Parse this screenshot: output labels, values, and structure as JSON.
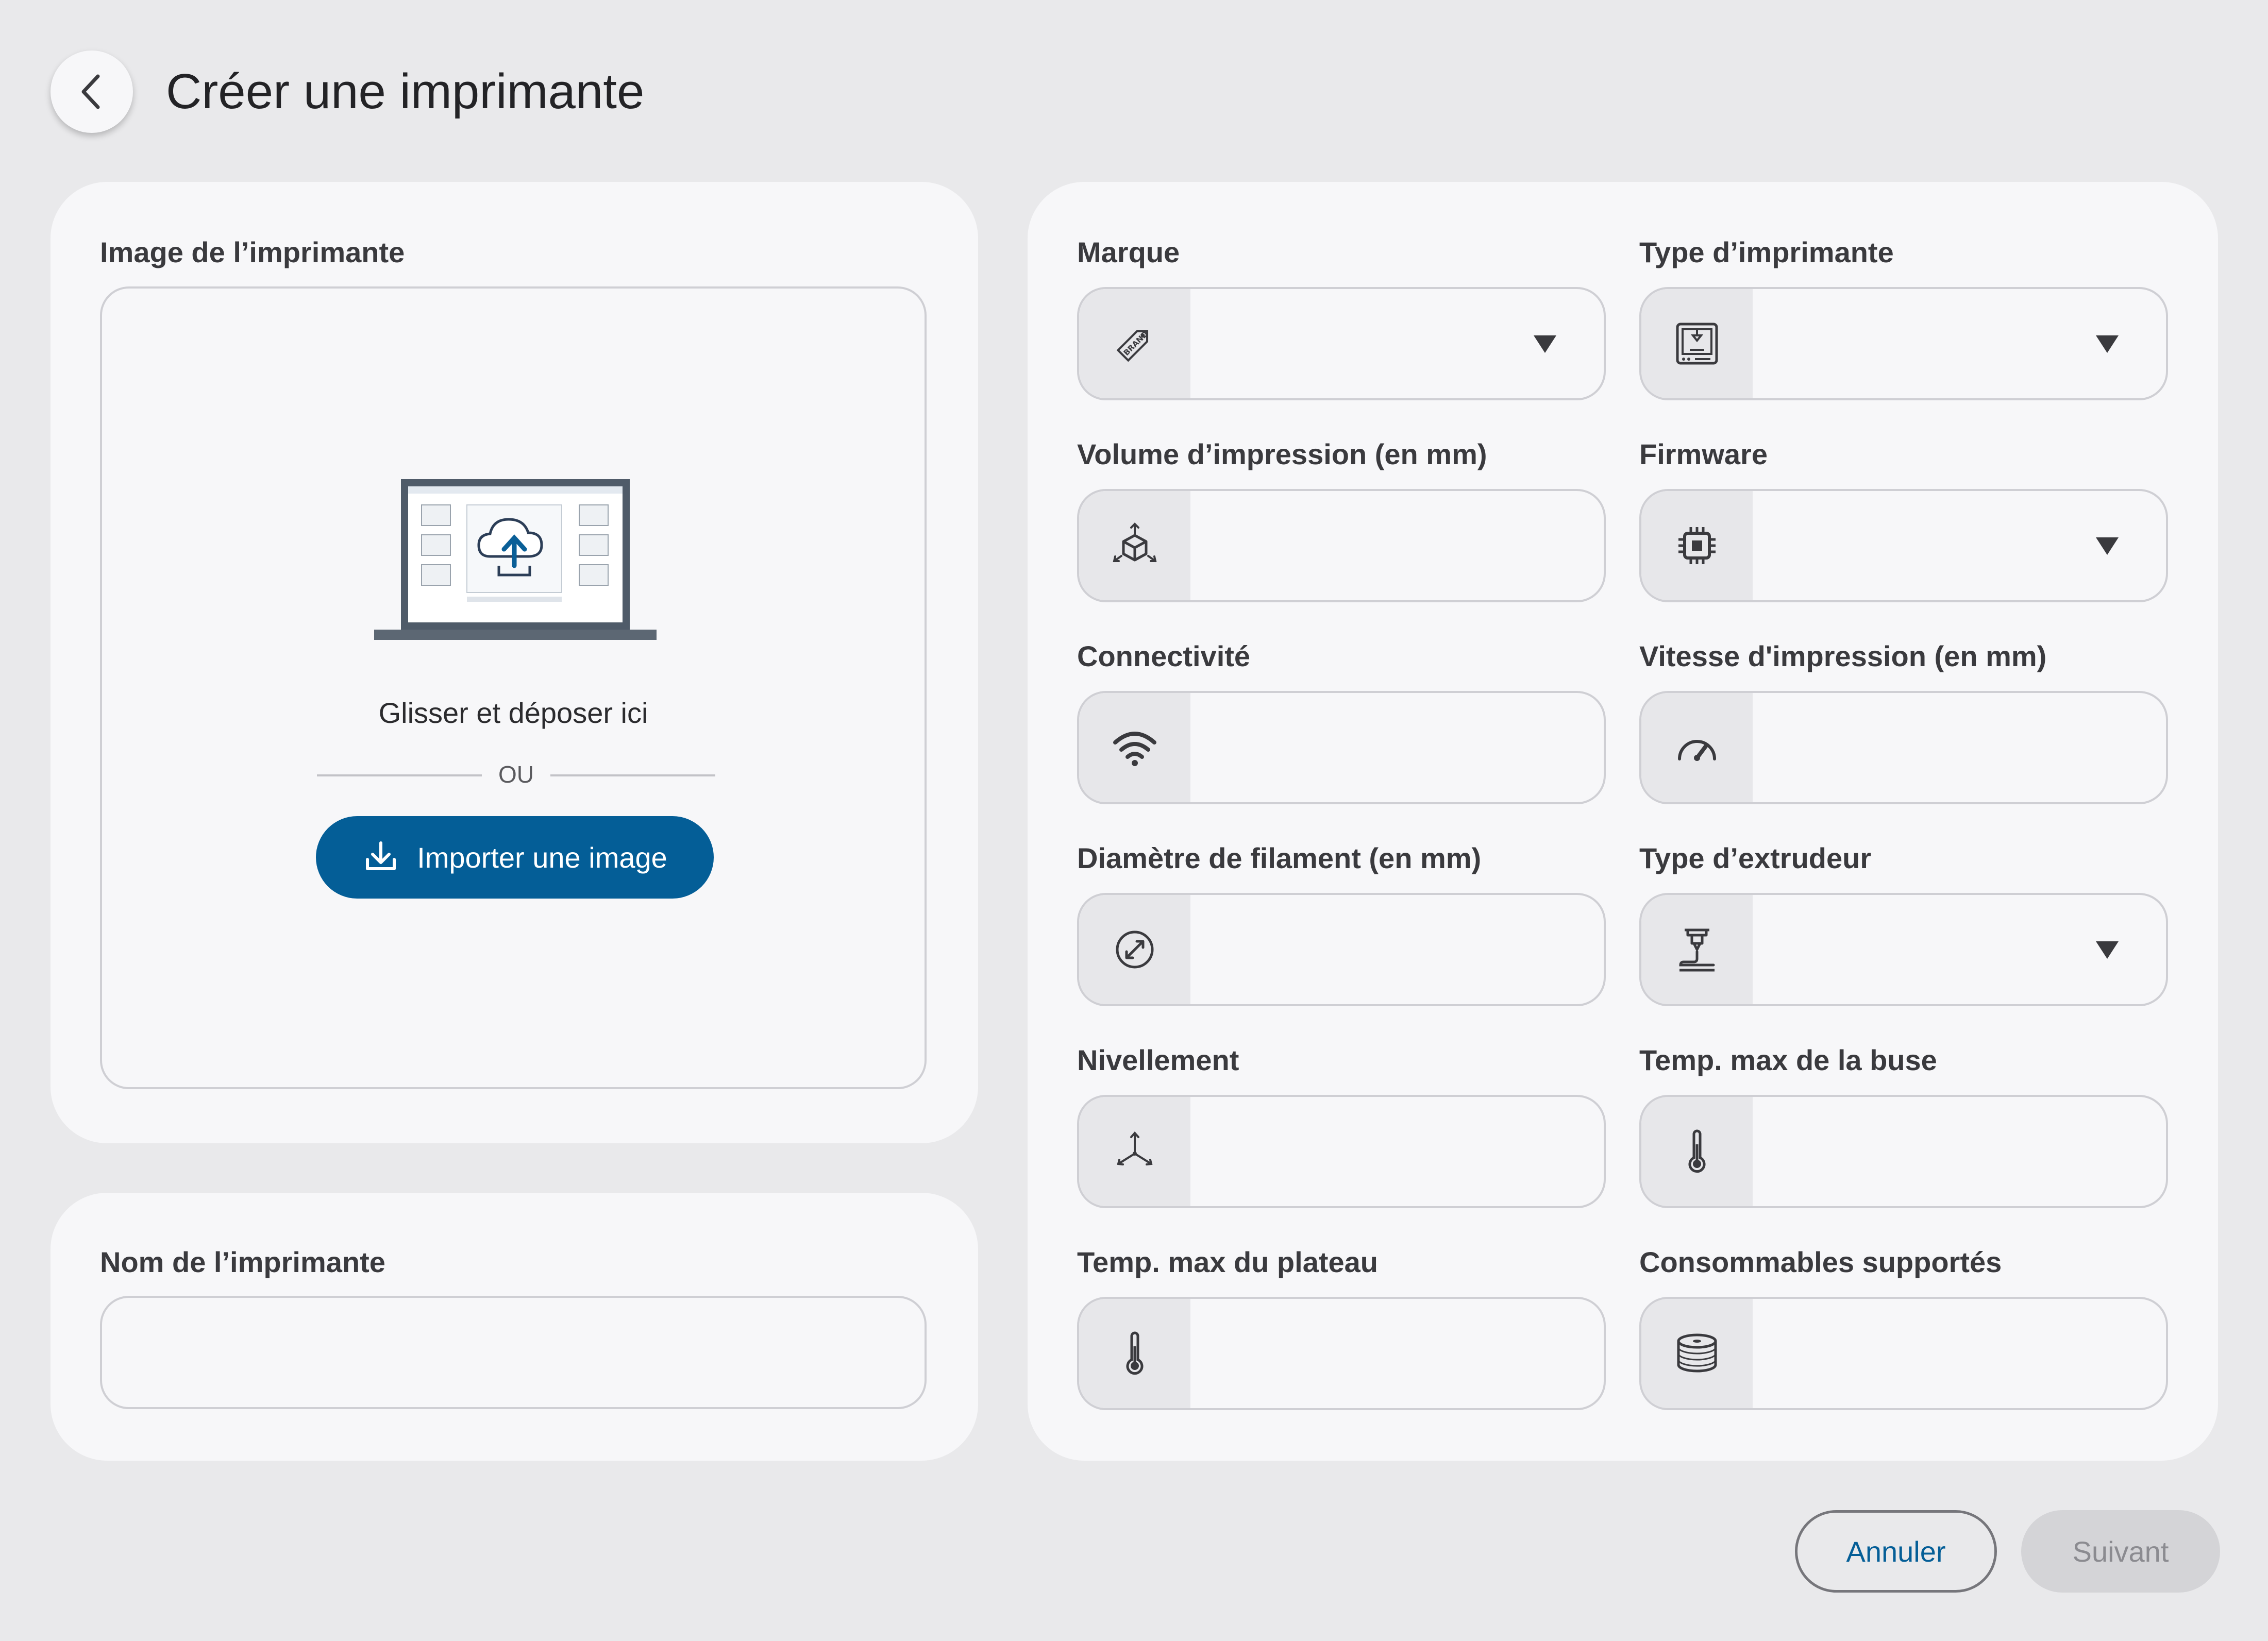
{
  "header": {
    "title": "Créer une imprimante",
    "back_icon": "chevron-left-icon"
  },
  "image_section": {
    "label": "Image de l’imprimante",
    "drop_text": "Glisser et déposer ici",
    "or_text": "OU",
    "import_button": "Importer une image",
    "import_icon": "download-icon"
  },
  "name_section": {
    "label": "Nom de l’imprimante",
    "value": ""
  },
  "fields": {
    "brand": {
      "label": "Marque",
      "icon": "brand-tag-icon",
      "value": ""
    },
    "printer_type": {
      "label": "Type d’imprimante",
      "icon": "printer-icon",
      "value": ""
    },
    "print_volume": {
      "label": "Volume d’impression (en mm)",
      "icon": "cube-volume-icon",
      "value": ""
    },
    "firmware": {
      "label": "Firmware",
      "icon": "chip-icon",
      "value": ""
    },
    "connectivity": {
      "label": "Connectivité",
      "icon": "wifi-icon",
      "value": ""
    },
    "print_speed": {
      "label": "Vitesse d'impression (en mm)",
      "icon": "speedometer-icon",
      "value": ""
    },
    "filament_diameter": {
      "label": "Diamètre de filament (en mm)",
      "icon": "diameter-icon",
      "value": ""
    },
    "extruder_type": {
      "label": "Type d’extrudeur",
      "icon": "extruder-icon",
      "value": ""
    },
    "leveling": {
      "label": "Nivellement",
      "icon": "axes-icon",
      "value": ""
    },
    "nozzle_temp": {
      "label": "Temp. max de la buse",
      "icon": "thermometer-icon",
      "value": ""
    },
    "bed_temp": {
      "label": "Temp. max du plateau",
      "icon": "thermometer-icon",
      "value": ""
    },
    "consumables": {
      "label": "Consommables supportés",
      "icon": "filament-spool-icon",
      "value": ""
    }
  },
  "footer": {
    "cancel": "Annuler",
    "next": "Suivant"
  },
  "colors": {
    "primary": "#045e97",
    "background": "#e9e9eb",
    "card": "#f7f7f9",
    "border": "#cfcfd4",
    "icon_bg": "#e7e7ea",
    "disabled_bg": "#d4d4d7",
    "disabled_text": "#8b8b90"
  }
}
